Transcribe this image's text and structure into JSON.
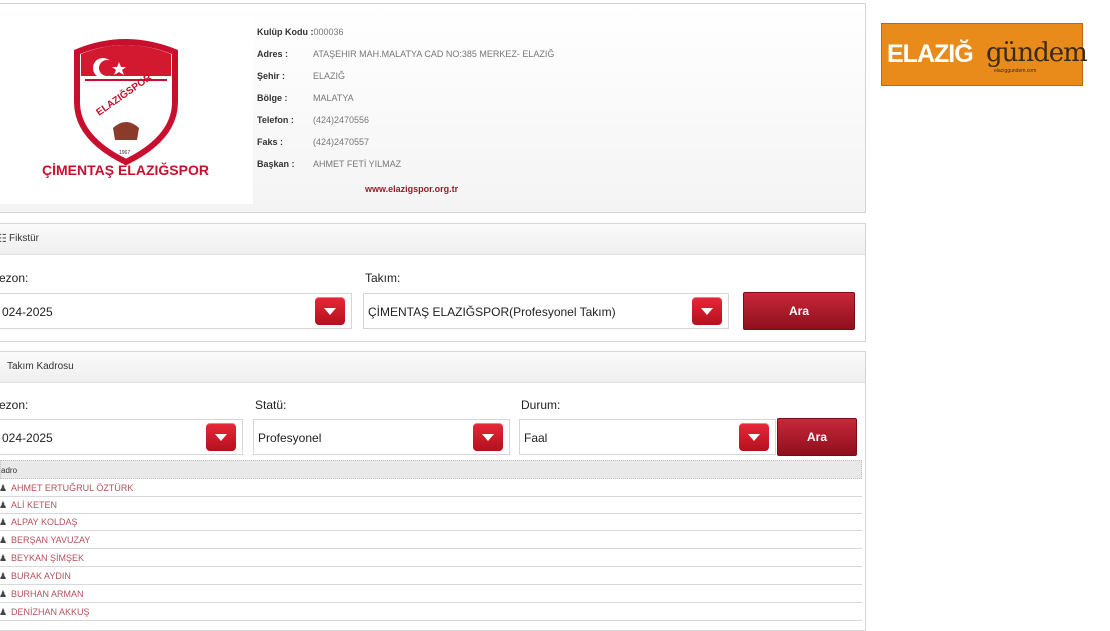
{
  "club": {
    "name": "ÇİMENTAŞ ELAZIĞSPOR",
    "logo_text": "ELAZIĞSPOR",
    "logo_year": "1967",
    "code_label": "Kulüp Kodu :",
    "code": "000036",
    "rows": [
      {
        "key": "Adres :",
        "value": "ATAŞEHIR MAH.MALATYA CAD NO:385 MERKEZ- ELAZIĞ"
      },
      {
        "key": "Şehir :",
        "value": "ELAZIĞ"
      },
      {
        "key": "Bölge :",
        "value": "MALATYA"
      },
      {
        "key": "Telefon :",
        "value": "(424)2470556"
      },
      {
        "key": "Faks :",
        "value": "(424)2470557"
      },
      {
        "key": "Başkan :",
        "value": "AHMET FETİ YILMAZ"
      }
    ],
    "website": "www.elazigspor.org.tr"
  },
  "fixture": {
    "title": "Fikstür",
    "season_label": "ezon:",
    "season_value": "024-2025",
    "team_label": "Takım:",
    "team_value": "ÇİMENTAŞ ELAZIĞSPOR(Profesyonel Takım)",
    "search_label": "Ara"
  },
  "squad": {
    "title": "Takım Kadrosu",
    "season_label": "ezon:",
    "season_value": "024-2025",
    "status_label": "Statü:",
    "status_value": "Profesyonel",
    "state_label": "Durum:",
    "state_value": "Faal",
    "search_label": "Ara",
    "roster_header": "adro",
    "players": [
      "AHMET ERTUĞRUL ÖZTÜRK",
      "ALİ KETEN",
      "ALPAY KOLDAŞ",
      "BERŞAN YAVUZAY",
      "BEYKAN ŞİMŞEK",
      "BURAK AYDIN",
      "BURHAN ARMAN",
      "DENİZHAN AKKUŞ"
    ]
  },
  "badge": {
    "left": "ELAZIĞ",
    "right": "gündem",
    "tagline": "elazıggundem.com"
  },
  "colors": {
    "accent_red": "#b3101e",
    "player_link": "#b4505e",
    "badge_orange": "#e98b1b"
  }
}
